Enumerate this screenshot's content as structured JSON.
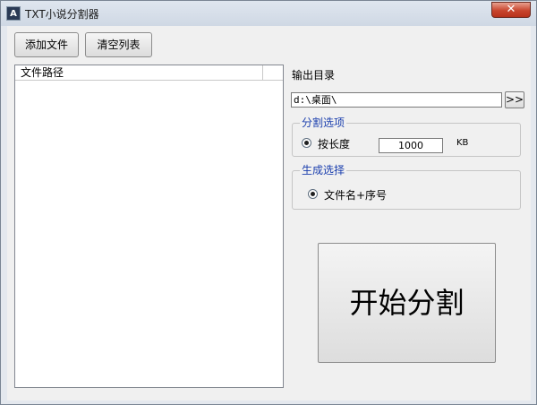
{
  "window": {
    "title": "TXT小说分割器",
    "app_icon_text": "A",
    "close_symbol": "✕"
  },
  "toolbar": {
    "add_label": "添加文件",
    "clear_label": "清空列表"
  },
  "file_list": {
    "column_header": "文件路径",
    "rows": []
  },
  "output": {
    "label": "输出目录",
    "directory": "d:\\桌面\\",
    "browse_label": ">>"
  },
  "split_options": {
    "title": "分割选项",
    "radio_label": "按长度",
    "length_value": "1000",
    "unit": "KB"
  },
  "generate_options": {
    "title": "生成选择",
    "radio_label": "文件名+序号"
  },
  "actions": {
    "start_label": "开始分割"
  },
  "colors": {
    "group_title": "#1b3fae",
    "close_button": "#c8452d"
  }
}
